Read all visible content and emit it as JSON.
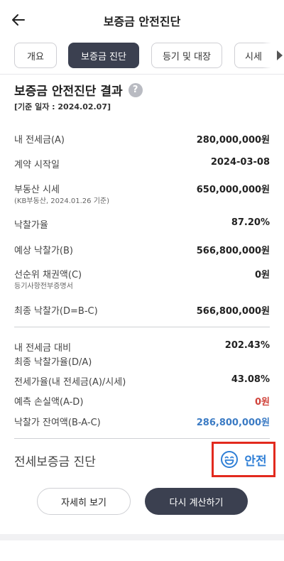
{
  "header": {
    "title": "보증금 안전진단"
  },
  "tabs": [
    {
      "label": "개요"
    },
    {
      "label": "보증금 진단"
    },
    {
      "label": "등기 및 대장"
    },
    {
      "label": "시세"
    }
  ],
  "result": {
    "title": "보증금 안전진단 결과",
    "help": "?",
    "base_date": "[기준 일자 : 2024.02.07]"
  },
  "rows": {
    "deposit": {
      "label": "내 전세금(A)",
      "value": "280,000,000원"
    },
    "start": {
      "label": "계약 시작일",
      "value": "2024-03-08"
    },
    "market": {
      "label": "부동산 시세",
      "sub": "(KB부동산, 2024.01.26 기준)",
      "value": "650,000,000원"
    },
    "rate": {
      "label": "낙찰가율",
      "value": "87.20%"
    },
    "expected": {
      "label": "예상 낙찰가(B)",
      "value": "566,800,000원"
    },
    "senior": {
      "label": "선순위 채권액(C)",
      "sub": "등기사항전부증명서",
      "value": "0원"
    },
    "final": {
      "label": "최종 낙찰가(D=B-C)",
      "value": "566,800,000원"
    },
    "ratio": {
      "label": "내 전세금 대비",
      "label2": "최종 낙찰가율(D/A)",
      "value": "202.43%"
    },
    "jeonse_rate": {
      "label": "전세가율(내 전세금(A)/시세)",
      "value": "43.08%"
    },
    "loss": {
      "label": "예측 손실액(A-D)",
      "value": "0원"
    },
    "remain": {
      "label": "낙찰가 잔여액(B-A-C)",
      "value": "286,800,000원"
    }
  },
  "diagnosis": {
    "label": "전세보증금 진단",
    "status": "안전"
  },
  "buttons": {
    "detail": "자세히 보기",
    "recalc": "다시 계산하기"
  },
  "colors": {
    "accent": "#3b4050",
    "safe": "#2f7fd6",
    "loss": "#d0433b",
    "remain": "#3b7bc4",
    "highlight": "#e22a1e"
  }
}
